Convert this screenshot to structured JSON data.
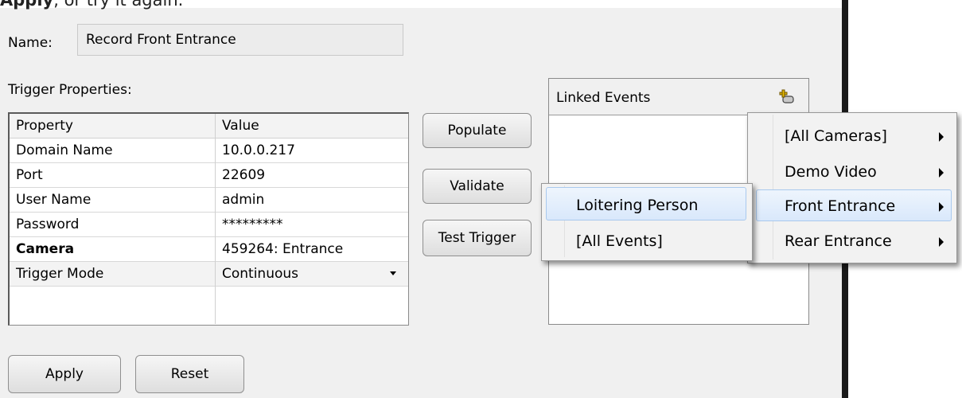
{
  "top_instruction": {
    "bold": "Apply",
    "rest": ", or try it again."
  },
  "name": {
    "label": "Name:",
    "value": "Record Front Entrance"
  },
  "trigger_properties_label": "Trigger Properties:",
  "grid": {
    "headers": [
      "Property",
      "Value"
    ],
    "rows": [
      {
        "property": "Domain Name",
        "value": "10.0.0.217"
      },
      {
        "property": "Port",
        "value": "22609"
      },
      {
        "property": "User Name",
        "value": "admin"
      },
      {
        "property": "Password",
        "value": "*********"
      },
      {
        "property": "Camera",
        "value": "459264: Entrance"
      },
      {
        "property": "Trigger Mode",
        "value": "Continuous"
      }
    ]
  },
  "buttons": {
    "populate": "Populate",
    "validate": "Validate",
    "test_trigger": "Test Trigger",
    "apply": "Apply",
    "reset": "Reset"
  },
  "linked_events": {
    "title": "Linked Events",
    "icon": "add-link-icon"
  },
  "camera_menu": [
    "[All Cameras]",
    "Demo Video",
    "Front Entrance",
    "Rear Entrance"
  ],
  "camera_menu_selected": "Front Entrance",
  "event_menu": [
    "Loitering Person",
    "[All Events]"
  ],
  "event_menu_selected": "Loitering Person",
  "colors": {
    "highlight": "#dce9fb",
    "panel": "#f0f0f0"
  }
}
